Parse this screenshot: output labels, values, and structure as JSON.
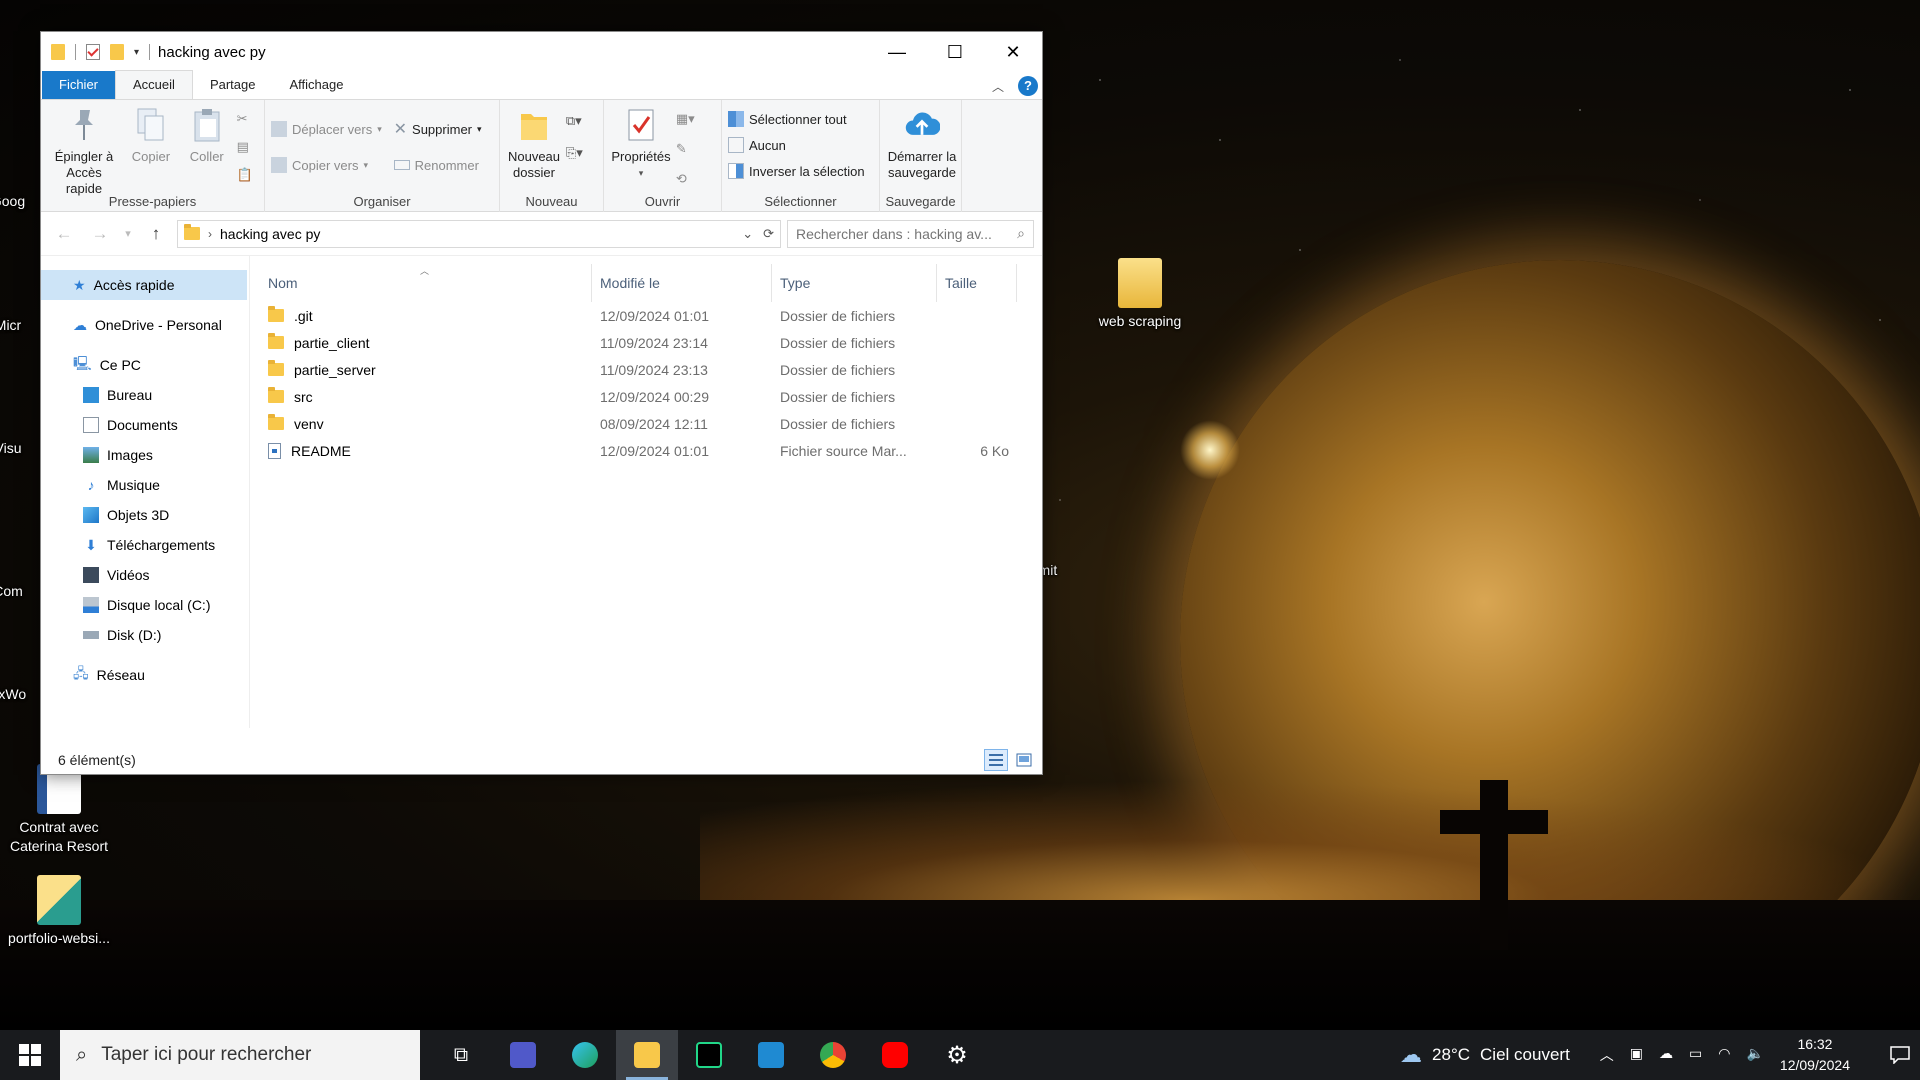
{
  "desktop": {
    "icons": [
      {
        "label": "web scraping"
      },
      {
        "label": "Contrat avec Caterina Resort"
      },
      {
        "label": "portfolio-websi..."
      }
    ],
    "partial_labels": [
      "Goog",
      "Micr",
      "Visu",
      "Com",
      "FxWo",
      "nmit"
    ]
  },
  "window": {
    "title": "hacking avec py",
    "tabs": [
      "Fichier",
      "Accueil",
      "Partage",
      "Affichage"
    ],
    "ribbon": {
      "clipboard": {
        "label": "Presse-papiers",
        "pin": "Épingler à\nAccès rapide",
        "copy": "Copier",
        "paste": "Coller"
      },
      "organize": {
        "label": "Organiser",
        "move_to": "Déplacer vers",
        "copy_to": "Copier vers",
        "delete": "Supprimer",
        "rename": "Renommer"
      },
      "new": {
        "label": "Nouveau",
        "new_folder": "Nouveau\ndossier"
      },
      "open": {
        "label": "Ouvrir",
        "properties": "Propriétés"
      },
      "select": {
        "label": "Sélectionner",
        "select_all": "Sélectionner tout",
        "select_none": "Aucun",
        "invert": "Inverser la sélection"
      },
      "backup": {
        "label": "Sauvegarde",
        "start_backup": "Démarrer la\nsauvegarde"
      }
    },
    "address": {
      "path": "hacking avec py",
      "search_placeholder": "Rechercher dans : hacking av..."
    },
    "nav": {
      "quick_access": "Accès rapide",
      "onedrive": "OneDrive - Personal",
      "this_pc": "Ce PC",
      "pc_items": [
        "Bureau",
        "Documents",
        "Images",
        "Musique",
        "Objets 3D",
        "Téléchargements",
        "Vidéos",
        "Disque local (C:)",
        "Disk (D:)"
      ],
      "network": "Réseau"
    },
    "columns": {
      "name": "Nom",
      "modified": "Modifié le",
      "type": "Type",
      "size": "Taille"
    },
    "files": [
      {
        "name": ".git",
        "modified": "12/09/2024 01:01",
        "type": "Dossier de fichiers",
        "size": ""
      },
      {
        "name": "partie_client",
        "modified": "11/09/2024 23:14",
        "type": "Dossier de fichiers",
        "size": ""
      },
      {
        "name": "partie_server",
        "modified": "11/09/2024 23:13",
        "type": "Dossier de fichiers",
        "size": ""
      },
      {
        "name": "src",
        "modified": "12/09/2024 00:29",
        "type": "Dossier de fichiers",
        "size": ""
      },
      {
        "name": "venv",
        "modified": "08/09/2024 12:11",
        "type": "Dossier de fichiers",
        "size": ""
      },
      {
        "name": "README",
        "modified": "12/09/2024 01:01",
        "type": "Fichier source Mar...",
        "size": "6 Ko"
      }
    ],
    "status": "6 élément(s)"
  },
  "taskbar": {
    "search_placeholder": "Taper ici pour rechercher",
    "weather_temp": "28°C",
    "weather_desc": "Ciel couvert",
    "time": "16:32",
    "date": "12/09/2024"
  },
  "colors": {
    "accent": "#1979ca",
    "folder": "#f8c84a",
    "selection": "#cde4f7",
    "taskbar": "#191b1e"
  }
}
